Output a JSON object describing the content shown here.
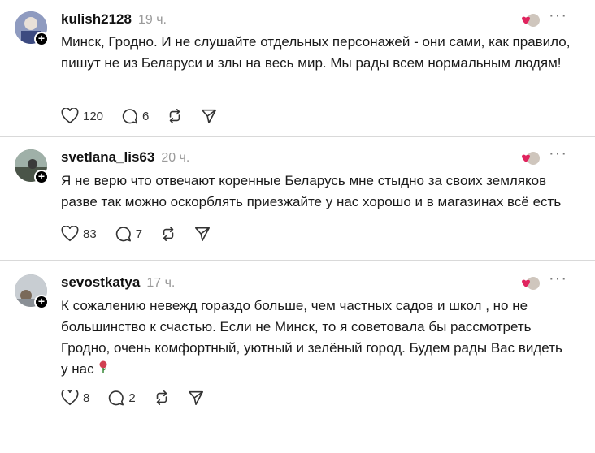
{
  "posts": [
    {
      "username": "kulish2128",
      "time": "19 ч.",
      "text": "Минск, Гродно. И не слушайте отдельных персонажей - они сами, как правило, пишут не из Беларуси и злы на весь мир. Мы рады всем нормальным людям!",
      "likes": "120",
      "replies": "6",
      "avatar_color": "#6c7aa8"
    },
    {
      "username": "svetlana_lis63",
      "time": "20 ч.",
      "text": "Я не верю что отвечают коренные Беларусь мне стыдно за своих земляков разве так можно оскорблять приезжайте у нас хорошо и в магазинах всё есть",
      "likes": "83",
      "replies": "7",
      "avatar_color": "#5c6a5a"
    },
    {
      "username": "sevostkatya",
      "time": "17 ч.",
      "text": "К сожалению невежд гораздо больше, чем частных садов и школ , но не большинство к счастью. Если не Минск, то я советовала бы рассмотреть Гродно, очень комфортный, уютный и зелёный город. Будем рады Вас видеть у нас",
      "likes": "8",
      "replies": "2",
      "avatar_color": "#9aa0a8"
    }
  ],
  "icons": {
    "like": "heart-icon",
    "reply": "comment-icon",
    "repost": "repost-icon",
    "share": "send-icon",
    "more": "more-icon"
  },
  "colors": {
    "divider": "#d9d9d9",
    "muted": "#9a9a9a",
    "accent_heart": "#e0245e"
  }
}
